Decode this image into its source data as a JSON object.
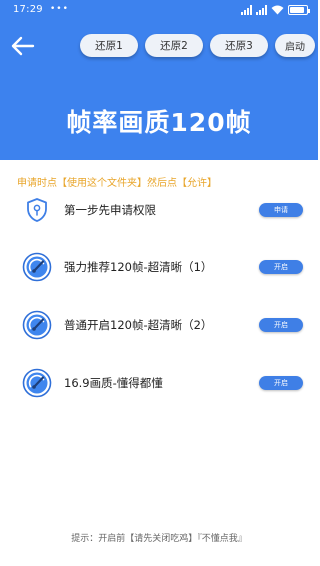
{
  "status_bar": {
    "time": "17:29",
    "dots": "•••",
    "battery_level": 0.9
  },
  "header": {
    "title": "帧率画质120帧",
    "buttons": [
      "还原1",
      "还原2",
      "还原3",
      "启动"
    ]
  },
  "instruction": "申请时点【使用这个文件夹】然后点【允许】",
  "rows": [
    {
      "label": "第一步先申请权限",
      "button": "申请",
      "icon": "shield-icon"
    },
    {
      "label": "强力推荐120帧-超清晰（1）",
      "button": "开启",
      "icon": "speedometer-icon"
    },
    {
      "label": "普通开启120帧-超清晰（2）",
      "button": "开启",
      "icon": "speedometer-icon"
    },
    {
      "label": "16.9画质-懂得都懂",
      "button": "开启",
      "icon": "speedometer-icon"
    }
  ],
  "footer": "提示：开启前【请先关闭吃鸡】『不懂点我』",
  "colors": {
    "header_bg": "#3d82ee",
    "accent": "#3f7fe6",
    "instruction": "#e8a52a"
  }
}
